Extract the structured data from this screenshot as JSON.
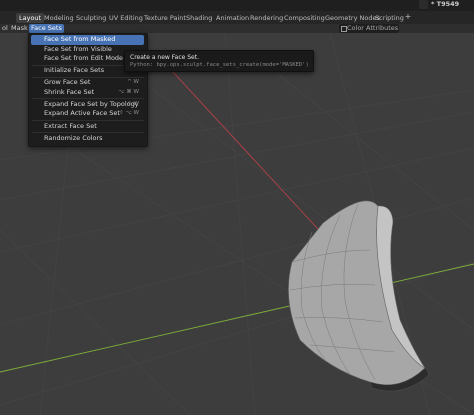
{
  "window": {
    "title": "* T9549"
  },
  "tabs": [
    {
      "label": "Layout",
      "active": true
    },
    {
      "label": "Modeling"
    },
    {
      "label": "Sculpting"
    },
    {
      "label": "UV Editing"
    },
    {
      "label": "Texture Paint"
    },
    {
      "label": "Shading"
    },
    {
      "label": "Animation"
    },
    {
      "label": "Rendering"
    },
    {
      "label": "Compositing"
    },
    {
      "label": "Geometry Nodes"
    },
    {
      "label": "Scripting"
    }
  ],
  "add_tab_label": "+",
  "header": {
    "menus": [
      "ol",
      "Mask",
      "Face Sets"
    ],
    "color_attributes_label": "Color Attributes"
  },
  "face_sets_menu": {
    "items": [
      {
        "label": "Face Set from Masked",
        "shortcut": "",
        "active": true
      },
      {
        "label": "Face Set from Visible",
        "shortcut": ""
      },
      {
        "label": "Face Set from Edit Mode Selection",
        "shortcut": ""
      },
      {
        "label": "Initialize Face Sets",
        "shortcut": ""
      },
      {
        "label": "Grow Face Set",
        "shortcut": "^ W"
      },
      {
        "label": "Shrink Face Set",
        "shortcut": "⌥ ⌘ W"
      },
      {
        "label": "Expand Face Set by Topology",
        "shortcut": "⇧ W"
      },
      {
        "label": "Expand Active Face Set",
        "shortcut": "⇧ ⌥ W"
      },
      {
        "label": "Extract Face Set",
        "shortcut": ""
      },
      {
        "label": "Randomize Colors",
        "shortcut": ""
      }
    ]
  },
  "tooltip": {
    "description": "Create a new Face Set.",
    "python": "Python: bpy.ops.sculpt.face_sets_create(mode='MASKED')"
  },
  "colors": {
    "accent": "#4772b3",
    "viewport_bg": "#3d3d3d",
    "x_axis": "#b8404a",
    "y_axis": "#7fb03a"
  }
}
